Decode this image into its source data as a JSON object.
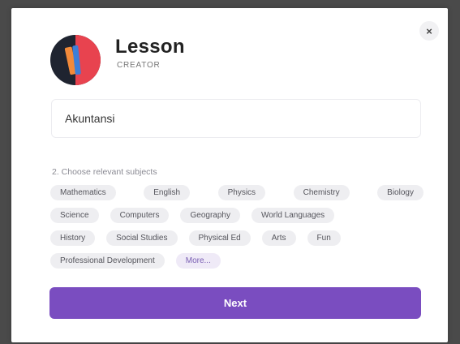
{
  "brand": {
    "title": "Lesson",
    "subtitle": "CREATOR"
  },
  "close": {
    "icon": "close-icon",
    "glyph": "×"
  },
  "topic": {
    "value": "Akuntansi"
  },
  "subjects": {
    "step_label": "2. Choose relevant subjects",
    "rows": [
      [
        "Mathematics",
        "English",
        "Physics",
        "Chemistry",
        "Biology"
      ],
      [
        "Science",
        "Computers",
        "Geography",
        "World Languages"
      ],
      [
        "History",
        "Social Studies",
        "Physical Ed",
        "Arts",
        "Fun"
      ],
      [
        "Professional Development"
      ]
    ],
    "more_label": "More..."
  },
  "actions": {
    "next_label": "Next"
  },
  "colors": {
    "accent": "#7a4dc0",
    "chip_bg": "#eeeef1",
    "logo_dark": "#1f2430",
    "logo_red": "#e8434f",
    "logo_orange": "#f28a3a",
    "logo_blue": "#3d7fd8"
  }
}
